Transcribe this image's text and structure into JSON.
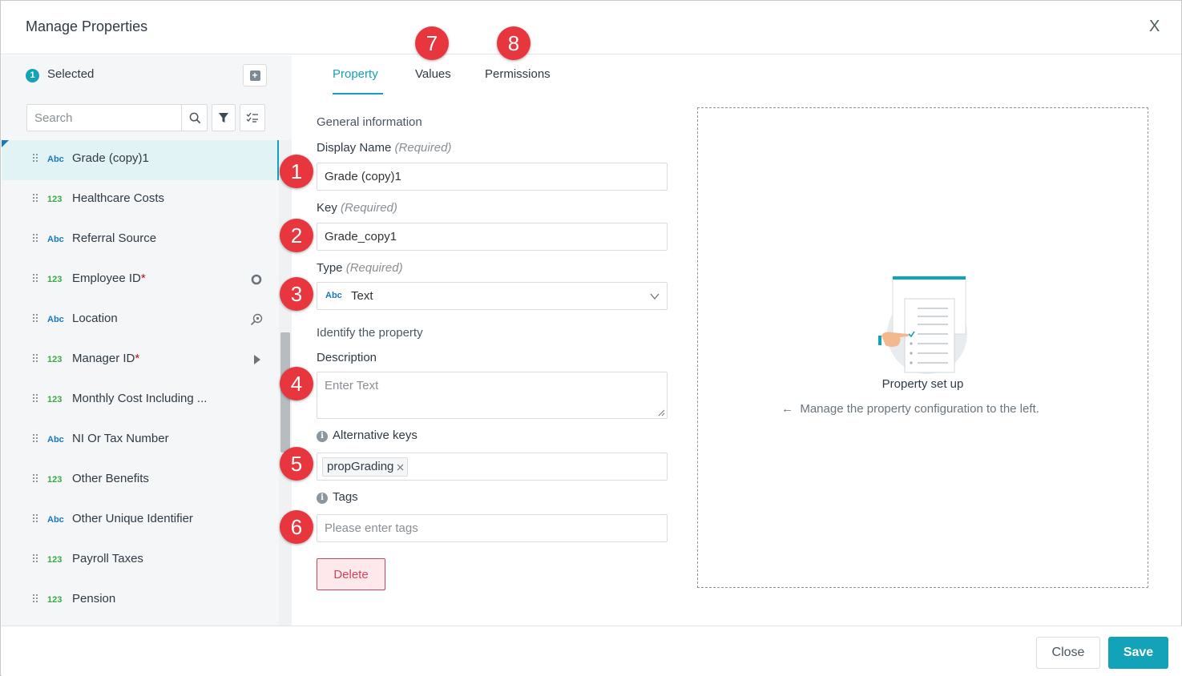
{
  "dialog": {
    "title": "Manage Properties",
    "close_glyph": "X"
  },
  "sidebar": {
    "selected_count": "1",
    "selected_label": "Selected",
    "add_icon": "add-square-icon",
    "search_placeholder": "Search",
    "items": [
      {
        "type": "Abc",
        "label": "Grade (copy)1",
        "required": "",
        "active": true,
        "icon": ""
      },
      {
        "type": "123",
        "label": "Healthcare Costs",
        "required": "",
        "icon": ""
      },
      {
        "type": "Abc",
        "label": "Referral Source",
        "required": "",
        "icon": ""
      },
      {
        "type": "123",
        "label": "Employee ID",
        "required": "*",
        "icon": "circle-ring-icon"
      },
      {
        "type": "Abc",
        "label": "Location",
        "required": "",
        "icon": "location-search-icon"
      },
      {
        "type": "123",
        "label": "Manager ID",
        "required": "*",
        "icon": "play-arrow-icon"
      },
      {
        "type": "123",
        "label": "Monthly Cost Including ...",
        "required": "",
        "icon": ""
      },
      {
        "type": "Abc",
        "label": "NI Or Tax Number",
        "required": "",
        "icon": ""
      },
      {
        "type": "123",
        "label": "Other Benefits",
        "required": "",
        "icon": ""
      },
      {
        "type": "Abc",
        "label": "Other Unique Identifier",
        "required": "",
        "icon": ""
      },
      {
        "type": "123",
        "label": "Payroll Taxes",
        "required": "",
        "icon": ""
      },
      {
        "type": "123",
        "label": "Pension",
        "required": "",
        "icon": ""
      }
    ]
  },
  "tabs": [
    {
      "label": "Property",
      "active": true
    },
    {
      "label": "Values"
    },
    {
      "label": "Permissions"
    }
  ],
  "form": {
    "general_heading": "General information",
    "display_name_label": "Display Name",
    "required_hint": "(Required)",
    "display_name_value": "Grade (copy)1",
    "key_label": "Key",
    "key_value": "Grade_copy1",
    "type_label": "Type",
    "type_tag": "Abc",
    "type_value": "Text",
    "identify_heading": "Identify the property",
    "description_label": "Description",
    "description_placeholder": "Enter Text",
    "alt_keys_label": "Alternative keys",
    "alt_keys": [
      "propGrading"
    ],
    "tags_label": "Tags",
    "tags_placeholder": "Please enter tags",
    "delete_label": "Delete"
  },
  "callouts": [
    "1",
    "2",
    "3",
    "4",
    "5",
    "6",
    "7",
    "8"
  ],
  "preview": {
    "title": "Property set up",
    "arrow": "←",
    "hint": "Manage the property configuration to the left."
  },
  "footer": {
    "close_label": "Close",
    "save_label": "Save"
  },
  "colors": {
    "accent": "#13a3b8",
    "callout": "#e8363f",
    "danger": "#d0445a",
    "abc_tag": "#1a79b8",
    "num_tag": "#3aa845"
  }
}
